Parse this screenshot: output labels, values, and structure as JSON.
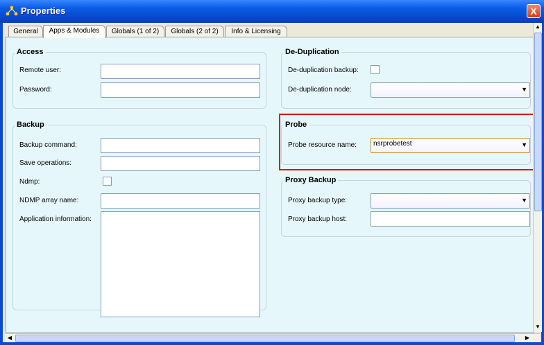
{
  "window": {
    "title": "Properties",
    "close_glyph": "X"
  },
  "tabs": [
    {
      "label": "General",
      "active": false
    },
    {
      "label": "Apps & Modules",
      "active": true
    },
    {
      "label": "Globals (1 of 2)",
      "active": false
    },
    {
      "label": "Globals (2 of 2)",
      "active": false
    },
    {
      "label": "Info & Licensing",
      "active": false
    }
  ],
  "access": {
    "title": "Access",
    "remote_user_label": "Remote user:",
    "remote_user_value": "",
    "password_label": "Password:",
    "password_value": ""
  },
  "backup": {
    "title": "Backup",
    "command_label": "Backup command:",
    "command_value": "",
    "save_ops_label": "Save operations:",
    "save_ops_value": "",
    "ndmp_label": "Ndmp:",
    "ndmp_checked": false,
    "ndmp_array_label": "NDMP array name:",
    "ndmp_array_value": "",
    "app_info_label": "Application information:",
    "app_info_value": ""
  },
  "dedup": {
    "title": "De-Duplication",
    "backup_label": "De-duplication backup:",
    "backup_checked": false,
    "node_label": "De-duplication node:",
    "node_value": ""
  },
  "probe": {
    "title": "Probe",
    "resource_label": "Probe resource name:",
    "resource_value": "nsrprobetest"
  },
  "proxy": {
    "title": "Proxy Backup",
    "type_label": "Proxy backup type:",
    "type_value": "",
    "host_label": "Proxy backup host:",
    "host_value": ""
  },
  "icons": {
    "dropdown": "▼",
    "scroll_up": "▲",
    "scroll_down": "▼",
    "scroll_left": "◀",
    "scroll_right": "▶"
  },
  "colors": {
    "title_bar": "#0a5ce6",
    "panel_bg": "#e6f7fb",
    "highlight": "#e00000"
  }
}
